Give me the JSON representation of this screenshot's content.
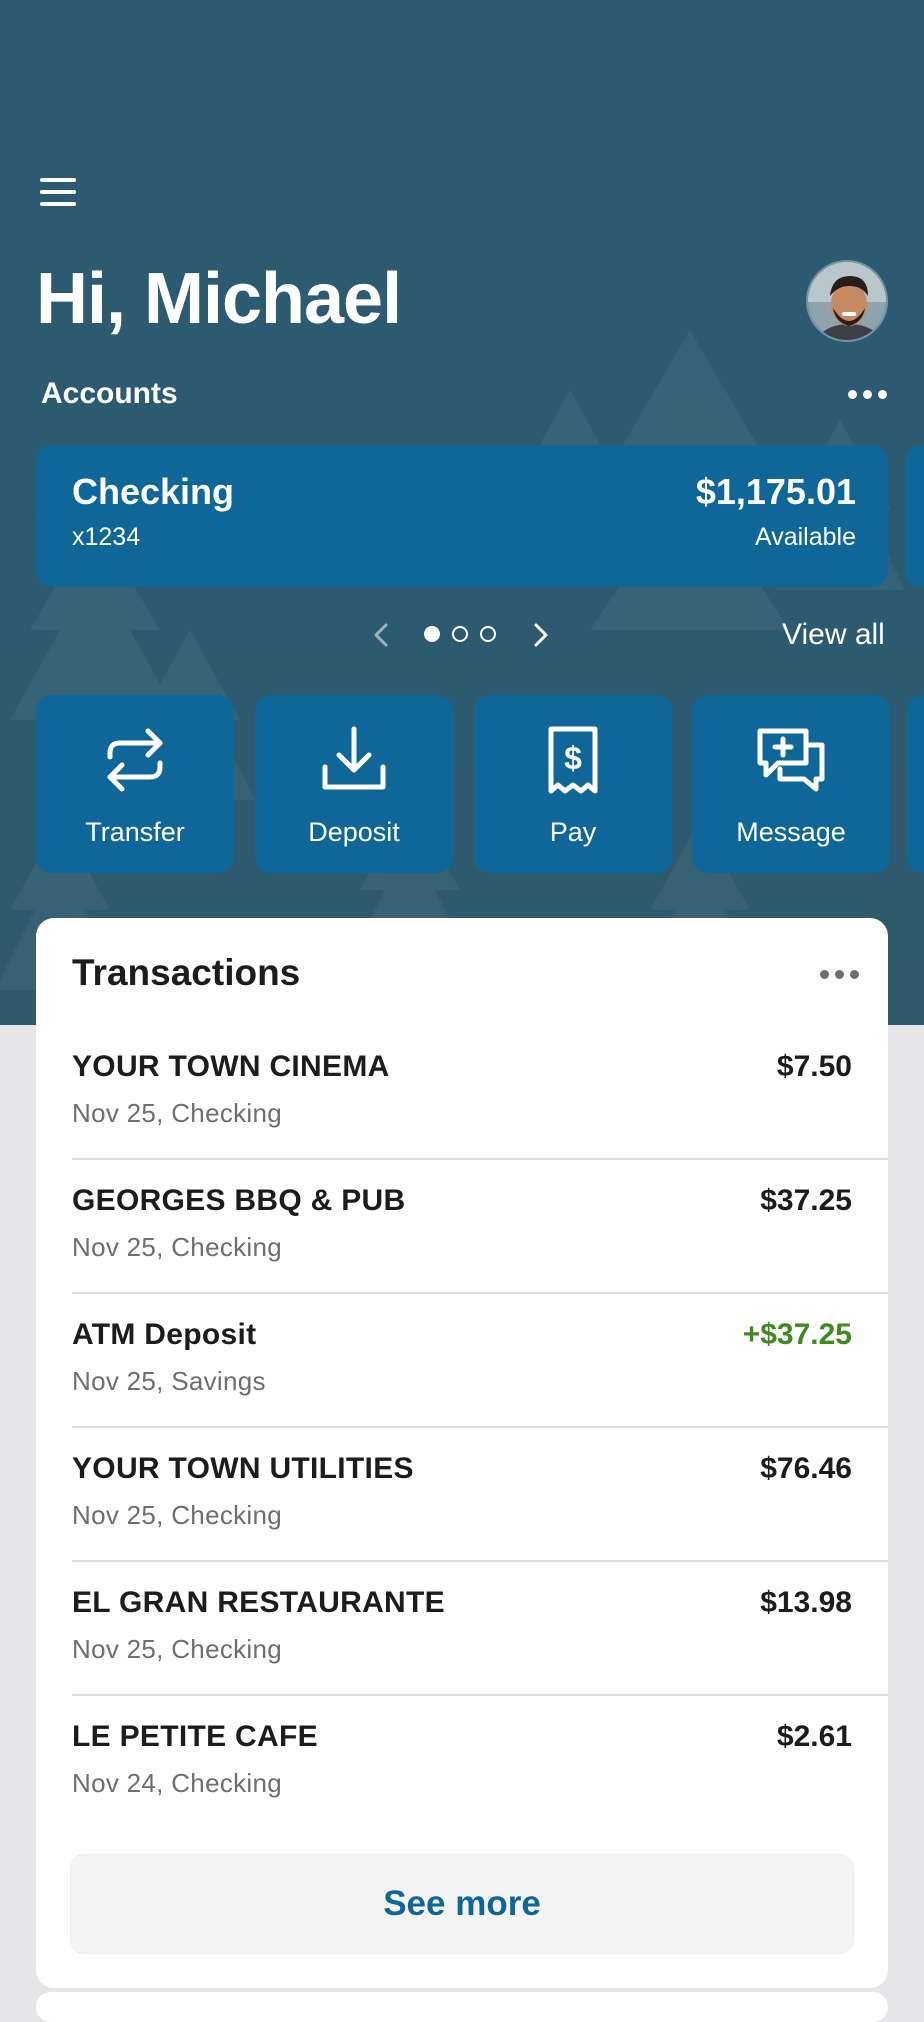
{
  "header": {
    "greeting": "Hi, Michael",
    "accounts_label": "Accounts"
  },
  "account": {
    "name": "Checking",
    "number": "x1234",
    "balance": "$1,175.01",
    "balance_label": "Available"
  },
  "pager": {
    "page_count": 3,
    "current_page": 1,
    "view_all": "View all"
  },
  "actions": [
    {
      "label": "Transfer",
      "icon": "transfer-icon"
    },
    {
      "label": "Deposit",
      "icon": "deposit-icon"
    },
    {
      "label": "Pay",
      "icon": "pay-bill-icon"
    },
    {
      "label": "Message",
      "icon": "message-icon"
    }
  ],
  "transactions": {
    "title": "Transactions",
    "items": [
      {
        "name": "YOUR TOWN CINEMA",
        "sub": "Nov 25, Checking",
        "amount": "$7.50"
      },
      {
        "name": "GEORGES BBQ & PUB",
        "sub": "Nov 25, Checking",
        "amount": "$37.25"
      },
      {
        "name": "ATM Deposit",
        "sub": "Nov 25, Savings",
        "amount": "+$37.25"
      },
      {
        "name": "YOUR TOWN UTILITIES",
        "sub": "Nov 25, Checking",
        "amount": "$76.46"
      },
      {
        "name": "EL GRAN RESTAURANTE",
        "sub": "Nov 25, Checking",
        "amount": "$13.98"
      },
      {
        "name": "LE PETITE CAFE",
        "sub": "Nov 24, Checking",
        "amount": "$2.61"
      }
    ],
    "see_more": "See more"
  },
  "colors": {
    "hero_bg": "#2b5a71",
    "accent": "#0f6699",
    "positive": "#3e8b1f"
  }
}
